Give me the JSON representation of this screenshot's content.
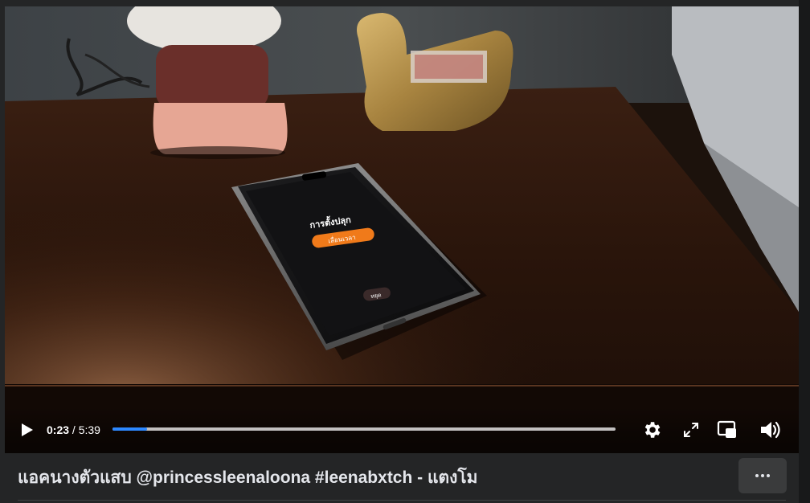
{
  "player": {
    "current_time": "0:23",
    "separator": " / ",
    "duration": "5:39",
    "progress_fraction": 0.068,
    "phone_screen": {
      "alarm_label": "การตั้งปลุก",
      "snooze_label": "เลื่อนเวลา",
      "stop_label": "หยุด"
    },
    "controls": {
      "play_icon": "play-icon",
      "settings_icon": "gear-icon",
      "fullscreen_icon": "expand-icon",
      "pip_icon": "picture-in-picture-icon",
      "volume_icon": "volume-icon"
    },
    "colors": {
      "progress_accent": "#2d88ff",
      "snooze_button": "#f07a1a"
    }
  },
  "caption": {
    "title": "แอคนางตัวแสบ @princessleenaloona #leenabxtch - แตงโม",
    "more_icon": "more-horizontal-icon"
  }
}
